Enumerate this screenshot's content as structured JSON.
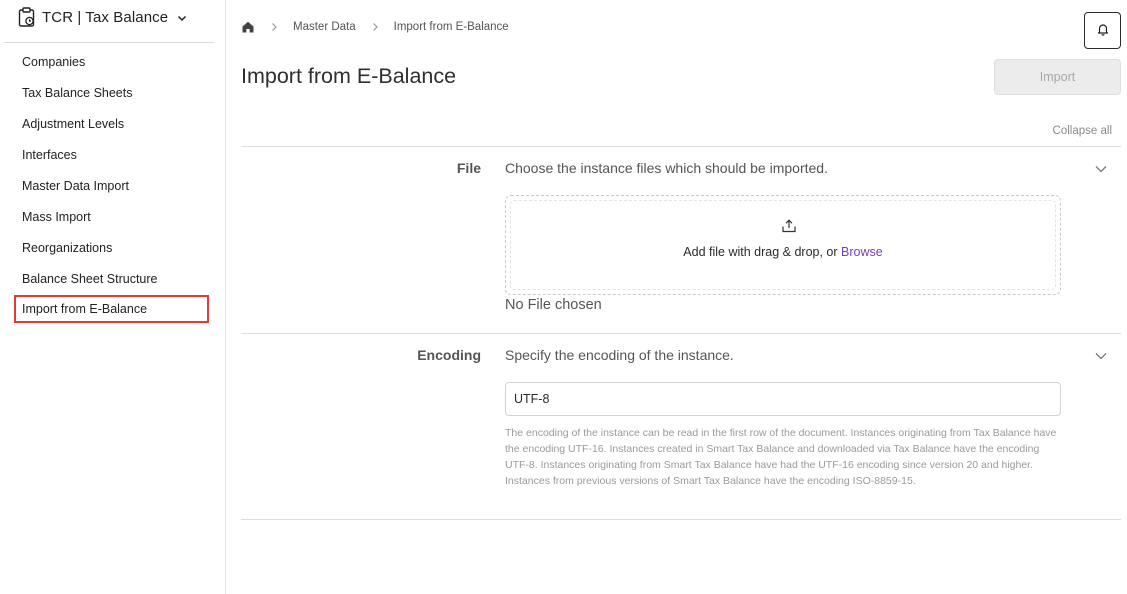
{
  "app": {
    "title": "TCR | Tax Balance",
    "icon": "clipboard-clock-icon"
  },
  "sidebar": {
    "items": [
      {
        "label": "Companies"
      },
      {
        "label": "Tax Balance Sheets"
      },
      {
        "label": "Adjustment Levels"
      },
      {
        "label": "Interfaces"
      },
      {
        "label": "Master Data Import"
      },
      {
        "label": "Mass Import"
      },
      {
        "label": "Reorganizations"
      },
      {
        "label": "Balance Sheet Structure"
      },
      {
        "label": "Import from E-Balance",
        "active": true
      }
    ]
  },
  "breadcrumb": {
    "home_icon": "home-icon",
    "items": [
      "Master Data",
      "Import from E-Balance"
    ]
  },
  "header": {
    "title": "Import from E-Balance",
    "import_label": "Import",
    "notification_icon": "bell-icon"
  },
  "collapse_all_label": "Collapse all",
  "sections": {
    "file": {
      "label": "File",
      "description": "Choose the instance files which should be imported.",
      "dropzone_text": "Add file with drag & drop, or ",
      "browse_label": "Browse",
      "status": "No File chosen"
    },
    "encoding": {
      "label": "Encoding",
      "description": "Specify the encoding of the instance.",
      "value": "UTF-8",
      "help": "The encoding of the instance can be read in the first row of the document. Instances originating from Tax Balance have the encoding UTF-16. Instances created in Smart Tax Balance and downloaded via Tax Balance have the encoding UTF-8. Instances originating from Smart Tax Balance have had the UTF-16 encoding since version 20 and higher. Instances from previous versions of Smart Tax Balance have the encoding ISO-8859-15."
    }
  },
  "colors": {
    "active_outline": "#e03a3a",
    "browse_link": "#7b3fb5",
    "disabled_button_bg": "#ececec"
  }
}
